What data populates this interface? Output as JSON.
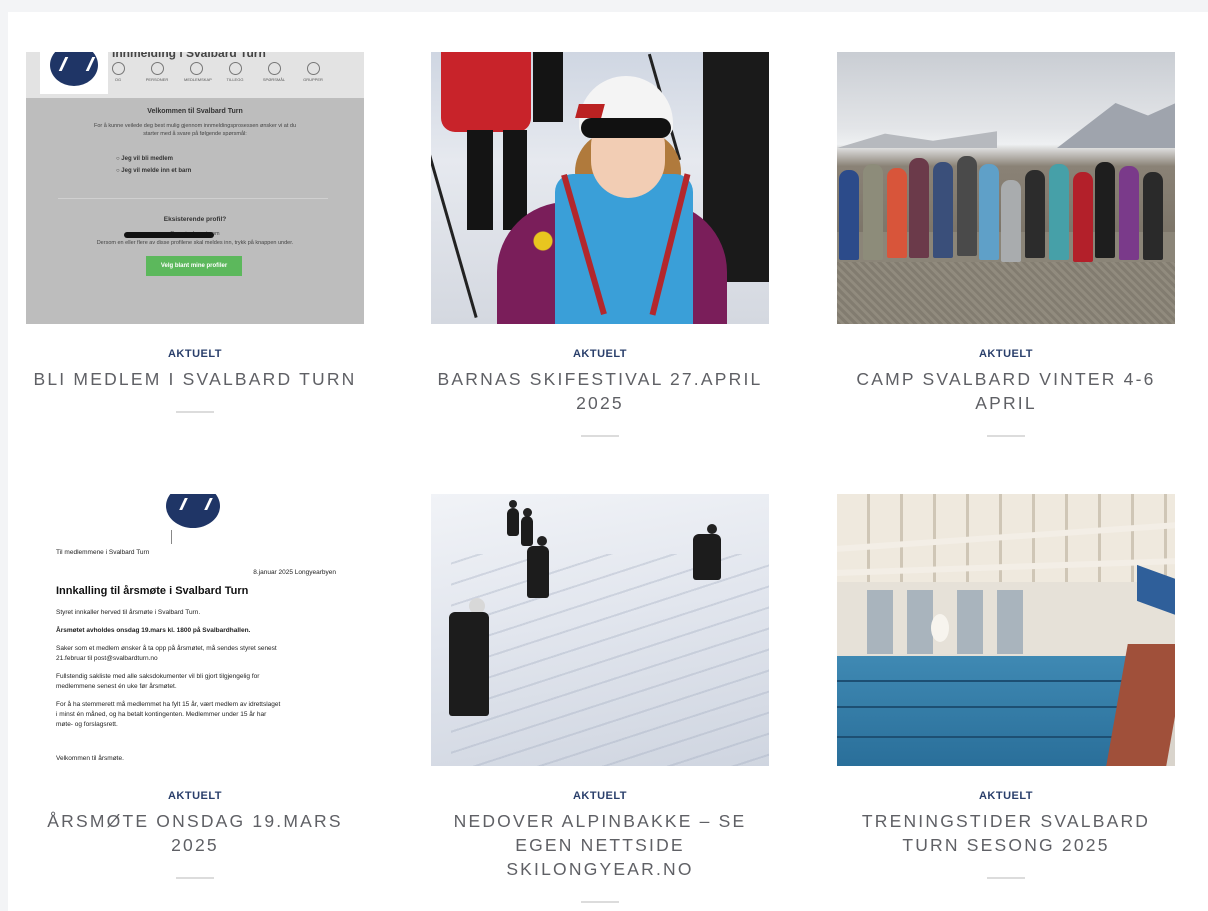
{
  "posts": [
    {
      "category": "AKTUELT",
      "title": "BLI MEDLEM I SVALBARD TURN",
      "image_alt": "Innmelding i Svalbard Turn",
      "screenshot": {
        "heading": "Innmelding i Svalbard Turn",
        "steps": [
          "OG",
          "PERSONER",
          "MEDLEMSKAP",
          "TILLEGG",
          "SPØRSMÅL",
          "GRUPPER"
        ],
        "welcome": "Velkommen til Svalbard Turn",
        "intro_1": "For å kunne veilede deg best mulig gjennom innmeldingsprosessen ønsker vi at du",
        "intro_2": "starter med å svare på følgende spørsmål:",
        "option_1": "Jeg vil bli medlem",
        "option_2": "Jeg vil melde inn et barn",
        "existing": "Eksisterende profil?",
        "logged_in": "Du er innlogget som",
        "hint": "Dersom en eller flere av disse profilene skal meldes inn, trykk på knappen under.",
        "button": "Velg blant mine profiler"
      }
    },
    {
      "category": "AKTUELT",
      "title": "BARNAS SKIFESTIVAL 27.APRIL 2025",
      "image_alt": "Barnas skifestival"
    },
    {
      "category": "AKTUELT",
      "title": "CAMP SVALBARD VINTER 4-6 APRIL",
      "image_alt": "Camp Svalbard vinter"
    },
    {
      "category": "AKTUELT",
      "title": "ÅRSMØTE ONSDAG 19.MARS 2025",
      "image_alt": "Innkalling til årsmøte",
      "document": {
        "to": "Til medlemmene i Svalbard Turn",
        "date": "8.januar 2025 Longyearbyen",
        "heading": "Innkalling til årsmøte i Svalbard Turn",
        "p1": "Styret innkaller herved til årsmøte i Svalbard Turn.",
        "p2": "Årsmøtet avholdes onsdag 19.mars kl. 1800 på Svalbardhallen.",
        "p3a": "Saker som et medlem ønsker å ta opp på årsmøtet, må sendes styret senest",
        "p3b": "21.februar til post@svalbardturn.no",
        "p4a": "Fullstendig sakliste med alle saksdokumenter vil bli gjort tilgjengelig for",
        "p4b": "medlemmene senest én uke før årsmøtet.",
        "p5a": "For å ha stemmerett må medlemmet ha fylt 15 år, vært medlem av idrettslaget",
        "p5b": "i minst én måned, og ha betalt kontingenten. Medlemmer under 15 år har",
        "p5c": "møte- og forslagsrett.",
        "p6": "Velkommen til årsmøte."
      }
    },
    {
      "category": "AKTUELT",
      "title": "NEDOVER ALPINBAKKE – SE EGEN NETTSIDE SKILONGYEAR.NO",
      "image_alt": "Alpinbakke"
    },
    {
      "category": "AKTUELT",
      "title": "TRENINGSTIDER SVALBARD TURN SESONG 2025",
      "image_alt": "Svømmehall"
    }
  ],
  "colors": {
    "category": "#2a3f6b",
    "title": "#5f6065",
    "separator": "#dcdcdc",
    "button_green": "#5cb85c",
    "logo_navy": "#1f3566"
  }
}
